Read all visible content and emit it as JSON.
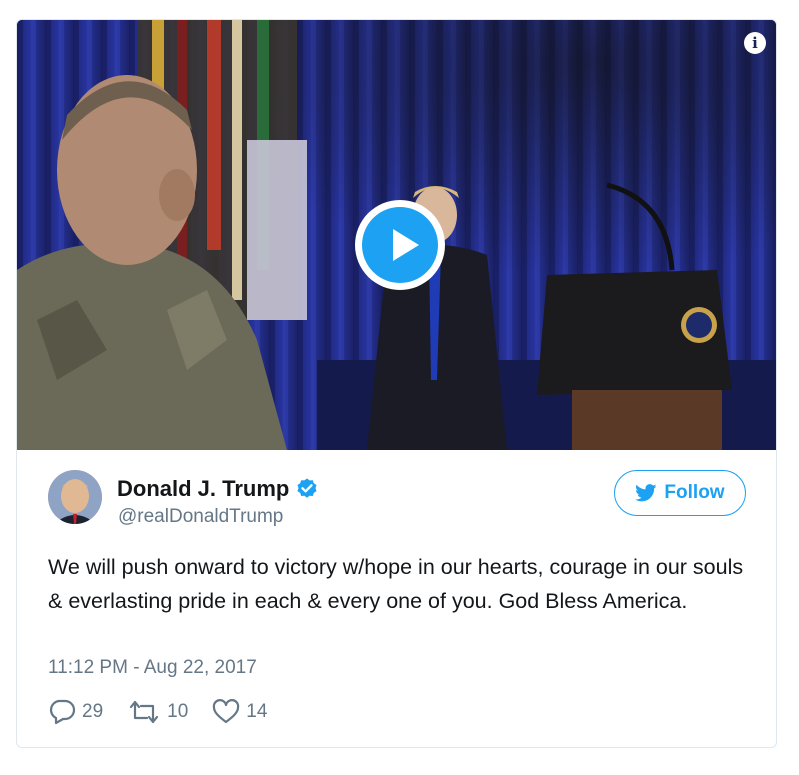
{
  "media": {
    "info_icon": "info-icon",
    "play_icon": "play-icon",
    "description_colors": {
      "curtain": "#1f2a8a",
      "accent": "#1da1f2"
    }
  },
  "author": {
    "name": "Donald J. Trump",
    "handle": "@realDonaldTrump",
    "verified": true,
    "avatar_icon": "avatar"
  },
  "follow": {
    "label": "Follow",
    "icon": "twitter-bird-icon"
  },
  "tweet": {
    "text": "We will push onward to victory w/hope in our hearts, courage in our souls & everlasting pride in each & every one of you. God Bless America.",
    "timestamp": "11:12 PM - Aug 22, 2017"
  },
  "actions": {
    "replies": "29",
    "retweets": "10",
    "likes": "14"
  },
  "colors": {
    "accent": "#1da1f2",
    "text": "#14171a",
    "secondary": "#657786",
    "border": "#e1e8ed"
  }
}
